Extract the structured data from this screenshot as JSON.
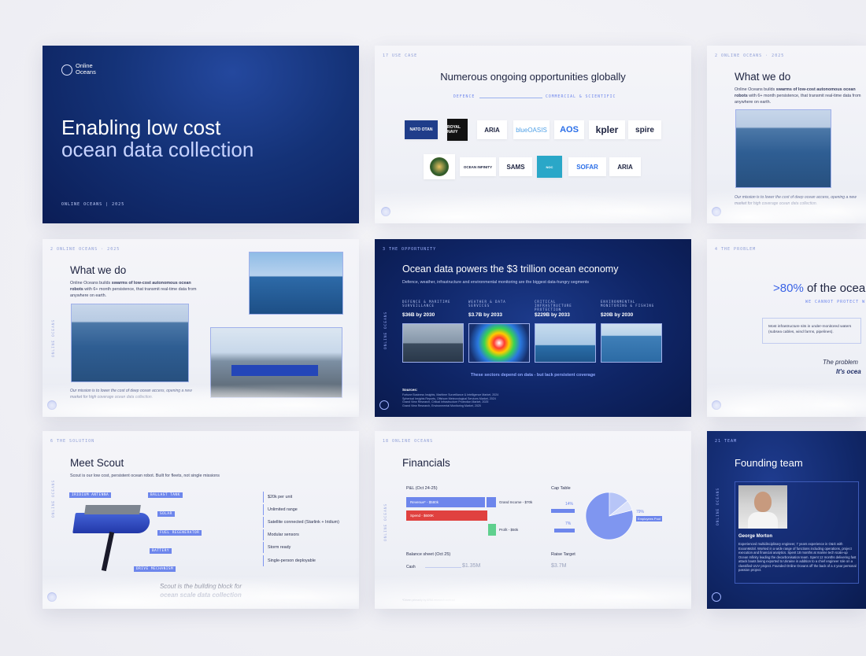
{
  "s1": {
    "brand_line1": "Online",
    "brand_line2": "Oceans",
    "title_line1": "Enabling low cost",
    "title_line2": "ocean data collection",
    "footer": "ONLINE OCEANS | 2025"
  },
  "s2": {
    "ref": "17  USE CASE",
    "title": "Numerous ongoing opportunities globally",
    "left_label": "DEFENCE",
    "right_label": "COMMERCIAL & SCIENTIFIC",
    "row1": [
      "NATO OTAN",
      "ROYAL NAVY",
      "ARIA",
      "blueOASIS",
      "AOS",
      "kpler",
      "spire"
    ],
    "row2": [
      "DoD",
      "OCEAN INFINITY",
      "SAMS",
      "NOC",
      "SOFAR",
      "ARIA"
    ]
  },
  "s3": {
    "ref": "2   ONLINE OCEANS · 2025",
    "title": "What we do",
    "body_a": "Online Oceans builds ",
    "body_b": "swarms of low-cost autonomous ocean robots",
    "body_c": " with 6+ month persistence, that transmit real-time data from anywhere on earth.",
    "mission": "Our mission is to lower the cost of deep ocean access, opening a new market for high coverage ocean data collection."
  },
  "s4": {
    "ref": "2   ONLINE OCEANS · 2025",
    "title": "What we do",
    "body_a": "Online Oceans builds ",
    "body_b": "swarms of low-cost autonomous ocean robots",
    "body_c": " with 6+ month persistence, that transmit real-time data from anywhere on earth.",
    "mission": "Our mission is to lower the cost of deep ocean access, opening a new market for high coverage ocean data collection."
  },
  "s5": {
    "ref": "3   THE OPPORTUNITY",
    "title": "Ocean data powers the $3 trillion ocean economy",
    "subtitle": "Defence, weather, infrastructure and environmental monitoring are the biggest data-hungry segments",
    "segments": [
      {
        "label": "DEFENCE & MARITIME SURVEILLANCE",
        "value": "$36B by 2030"
      },
      {
        "label": "WEATHER & DATA SERVICES",
        "value": "$3.7B by 2033"
      },
      {
        "label": "CRITICAL INFRASTRUCTURE PROTECTION",
        "value": "$229B by 2033"
      },
      {
        "label": "ENVIRONMENTAL MONITORING & FISHING",
        "value": "$20B by 2030"
      }
    ],
    "footer": "These sectors depend on data - but lack persistent coverage",
    "sources_title": "Sources:",
    "sources": [
      "Fortune Business Insights, Maritime Surveillance & Intelligence Market, 2024",
      "Spherical Insights Reports, Offshore Meteorological Services Market, 2024",
      "Grand View Research, Critical Infrastructure Protection Market, 2025",
      "Grand View Research, Environmental Monitoring Market, 2025"
    ]
  },
  "s6": {
    "ref": "4   THE PROBLEM",
    "stat": ">80%",
    "stat_rest": " of the ocea",
    "caps": "WE CANNOT PROTECT W",
    "body": "Most infrastructure sits in under-monitored waters (subsea cables, wind farms, pipelines).",
    "closing_a": "The problem",
    "closing_b": "It's ocea"
  },
  "s7": {
    "ref": "6   THE SOLUTION",
    "title": "Meet Scout",
    "subtitle": "Scout is our low cost, persistent ocean robot. Built for fleets, not single missions",
    "chips": [
      "IRIDIUM ANTENNA",
      "BALLAST TANK",
      "SOLAR",
      "FUEL REGENERATOR",
      "BATTERY",
      "DRIVE MECHANISM"
    ],
    "features": [
      "$20k per unit",
      "Unlimited range",
      "Satellite connected (Starlink + Iridium)",
      "Modular sensors",
      "Storm ready",
      "Single-person deployable"
    ],
    "closing_a": "Scout is the building block for",
    "closing_b": "ocean scale data collection"
  },
  "s8": {
    "ref": "18  ONLINE OCEANS",
    "title": "Financials",
    "pnl_title": "P&L (Oct 24-25)",
    "revenue": "Revenue* - $580k",
    "spend": "Spend - $600K",
    "grand": "Grand Income - $70k",
    "profit": "Profit - $50k",
    "cap_title": "Cap Table",
    "cap_pct1": "14%",
    "cap_pct2": "7%",
    "cap_pct3": "79%",
    "cap_lbl3": "Employees Pool",
    "balance_title": "Balance sheet (Oct 25)",
    "cash_label": "Cash",
    "cash_value": "$1.35M",
    "raise_title": "Raise Target",
    "raise_value": "$3.7M",
    "footnote": "*Driven primarily by ARIA research contract",
    "chart_data": {
      "type": "pie",
      "values": [
        79,
        14,
        7
      ],
      "labels": [
        "Employees Pool",
        "",
        ""
      ]
    }
  },
  "s9": {
    "ref": "21  TEAM",
    "title": "Founding team",
    "name": "George Morton",
    "bio": "Experienced multidisciplinary engineer, 7 years experience in O&G with ExxonMobil. Worked in a wide range of functions including operations, project execution and financial analytics. Spent 18 months at marine tech scale-up Ocean Infinity leading the decarbonisation team. Spent 12 months delivering fast attack boats being exported to Ukraine in addition to a chief engineer role on a classified UUV project. Founded Online Oceans off the back of a 4 year personal passion project."
  },
  "colors": {
    "accent": "#5b79ea",
    "navy": "#0f2566",
    "revenue": "#6d86ec",
    "spend": "#e0413f",
    "profit": "#5fd08e"
  }
}
